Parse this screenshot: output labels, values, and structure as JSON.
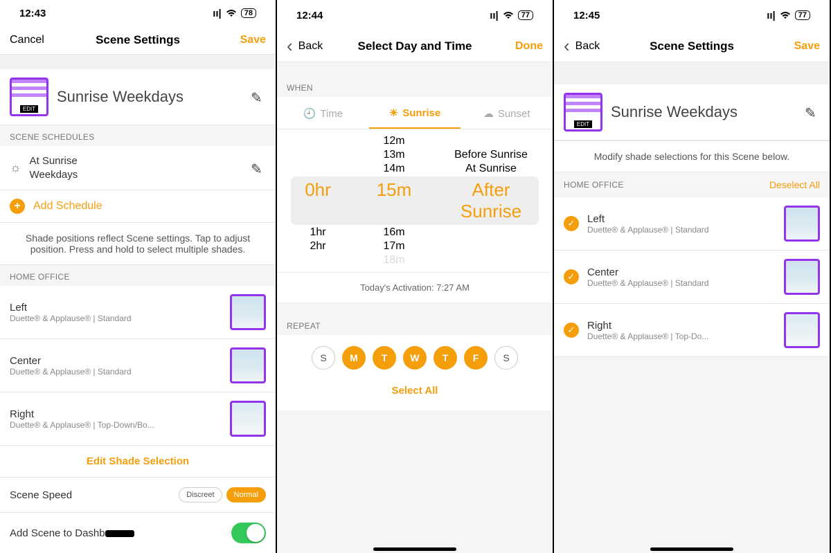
{
  "left": {
    "status": {
      "time": "12:43",
      "battery": "78"
    },
    "nav": {
      "left": "Cancel",
      "title": "Scene Settings",
      "right": "Save"
    },
    "scene": {
      "name": "Sunrise Weekdays",
      "badge": "EDIT"
    },
    "schedules_header": "SCENE SCHEDULES",
    "schedule": {
      "line1": "At Sunrise",
      "line2": "Weekdays"
    },
    "add_schedule": "Add Schedule",
    "hint": "Shade positions reflect Scene settings. Tap to adjust position. Press and hold to select multiple shades.",
    "room": "HOME OFFICE",
    "shades": [
      {
        "name": "Left",
        "sub": "Duette® & Applause® | Standard"
      },
      {
        "name": "Center",
        "sub": "Duette® & Applause® | Standard"
      },
      {
        "name": "Right",
        "sub": "Duette® & Applause® | Top-Down/Bo..."
      }
    ],
    "edit_shade": "Edit Shade Selection",
    "speed": {
      "label": "Scene Speed",
      "opt1": "Discreet",
      "opt2": "Normal"
    },
    "dashboard": "Add Scene to Dashboard"
  },
  "mid": {
    "status": {
      "time": "12:44",
      "battery": "77"
    },
    "nav": {
      "left": "Back",
      "title": "Select Day and Time",
      "right": "Done"
    },
    "when": "WHEN",
    "tabs": {
      "time": "Time",
      "sunrise": "Sunrise",
      "sunset": "Sunset"
    },
    "picker": {
      "hrs": [
        "",
        "",
        "",
        "0hr",
        "1hr",
        "2hr",
        ""
      ],
      "mins": [
        "12m",
        "13m",
        "14m",
        "15m",
        "16m",
        "17m",
        "18m"
      ],
      "labels": [
        "",
        "Before Sunrise",
        "At Sunrise",
        "After Sunrise",
        "",
        "",
        ""
      ]
    },
    "activation": "Today's Activation: 7:27 AM",
    "repeat": "REPEAT",
    "days": {
      "s1": "S",
      "m": "M",
      "t1": "T",
      "w": "W",
      "t2": "T",
      "f": "F",
      "s2": "S"
    },
    "select_all": "Select All"
  },
  "right": {
    "status": {
      "time": "12:45",
      "battery": "77"
    },
    "nav": {
      "left": "Back",
      "title": "Scene Settings",
      "right": "Save"
    },
    "scene": {
      "name": "Sunrise Weekdays",
      "badge": "EDIT"
    },
    "hint": "Modify shade selections for this Scene below.",
    "room": "HOME OFFICE",
    "deselect": "Deselect All",
    "shades": [
      {
        "name": "Left",
        "sub": "Duette® & Applause® | Standard"
      },
      {
        "name": "Center",
        "sub": "Duette® & Applause® | Standard"
      },
      {
        "name": "Right",
        "sub": "Duette® & Applause® | Top-Do..."
      }
    ]
  }
}
